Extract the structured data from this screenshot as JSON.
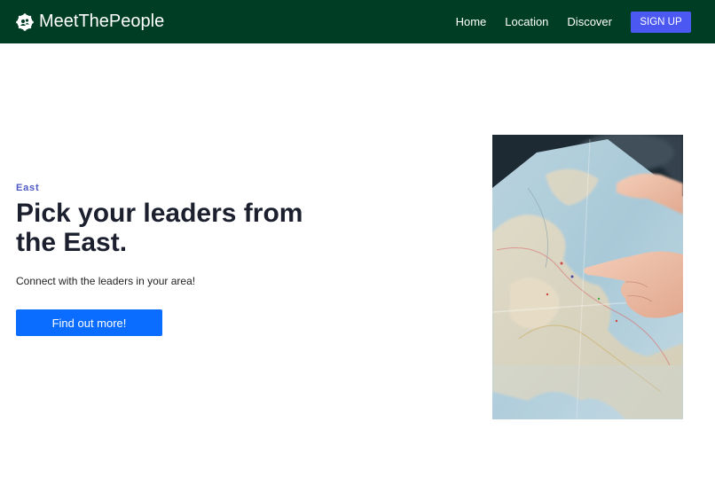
{
  "header": {
    "brand_name": "MeetThePeople",
    "brand_icon": "people-logo-icon",
    "nav": [
      {
        "label": "Home"
      },
      {
        "label": "Location"
      },
      {
        "label": "Discover"
      }
    ],
    "signup_label": "SIGN UP",
    "background_color": "#003d25",
    "signup_color": "#4c58f2"
  },
  "hero": {
    "eyebrow": "East",
    "headline": "Pick your leaders from\nthe East.",
    "subtext": "Connect with the leaders in your area!",
    "cta_label": "Find out more!",
    "cta_color": "#0a6dff",
    "image": "map-with-pointing-hand-photo"
  }
}
